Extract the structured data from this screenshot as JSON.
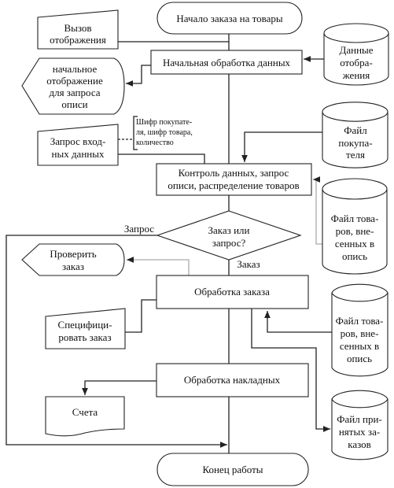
{
  "start": "Начало заказа на товары",
  "initial_processing": "Начальная обработка данных",
  "display_data": [
    "Данные",
    "отобра-",
    "жения"
  ],
  "call_display": [
    "Вызов",
    "отображения"
  ],
  "initial_display": [
    "начальное",
    "отображение",
    "для запроса",
    "описи"
  ],
  "input_request": [
    "Запрос вход-",
    "ных данных"
  ],
  "annotation": [
    "Шифр покупате-",
    "ля, шифр товара,",
    "количество"
  ],
  "customer_file": [
    "Файл",
    "покупа-",
    "теля"
  ],
  "control": [
    "Контроль данных, запрос",
    "описи, распределение товаров"
  ],
  "goods_file_1": [
    "Файл това-",
    "ров, вне-",
    "сенных в",
    "опись"
  ],
  "decision": [
    "Заказ или",
    "запрос?"
  ],
  "label_request": "Запрос",
  "label_order": "Заказ",
  "check_order": [
    "Проверить",
    "заказ"
  ],
  "order_processing": "Обработка заказа",
  "specify_order": [
    "Специфици-",
    "ровать заказ"
  ],
  "goods_file_2": [
    "Файл това-",
    "ров, вне-",
    "сенных в",
    "опись"
  ],
  "invoice_processing": "Обработка накладных",
  "invoices": "Счета",
  "accepted_orders_file": [
    "Файл при-",
    "нятых за-",
    "казов"
  ],
  "end": "Конец работы"
}
